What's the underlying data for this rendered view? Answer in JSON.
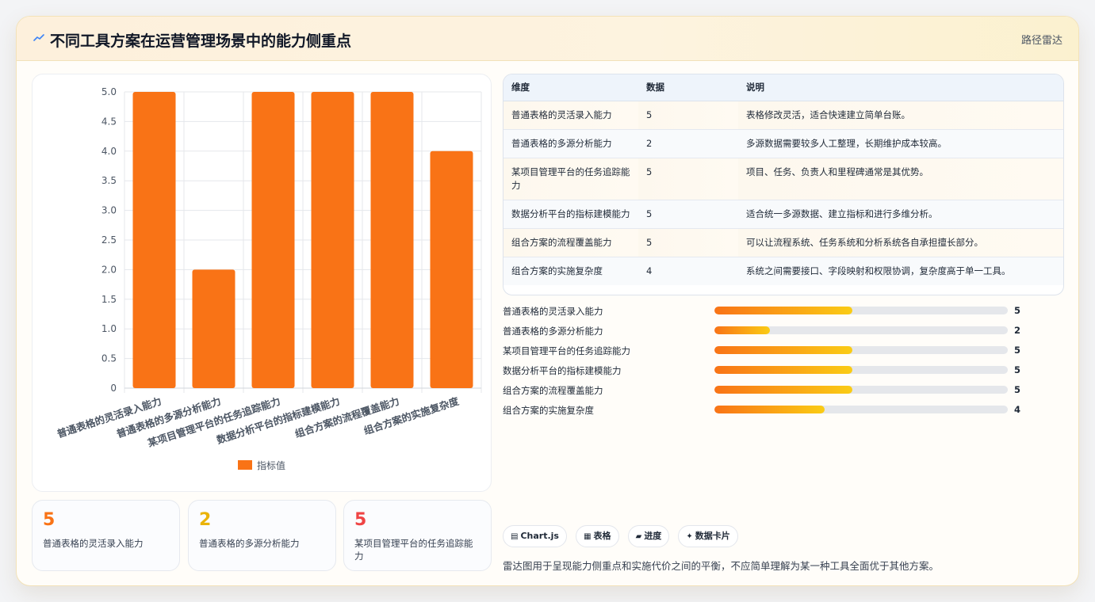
{
  "header": {
    "title": "不同工具方案在运营管理场景中的能力侧重点",
    "link_label": "路径雷达"
  },
  "colors": {
    "bar": "#f97316",
    "stat_orange": "#f97316",
    "stat_amber": "#eab308",
    "stat_red": "#ef4444",
    "progress_start": "#f97316",
    "progress_end": "#facc15"
  },
  "chart_data": {
    "type": "bar",
    "categories": [
      "普通表格的灵活录入能力",
      "普通表格的多源分析能力",
      "某项目管理平台的任务追踪能力",
      "数据分析平台的指标建模能力",
      "组合方案的流程覆盖能力",
      "组合方案的实施复杂度"
    ],
    "series": [
      {
        "name": "指标值",
        "values": [
          5,
          2,
          5,
          5,
          5,
          4
        ]
      }
    ],
    "ylim": [
      0,
      5
    ],
    "yticks": [
      "0",
      "0.5",
      "1.0",
      "1.5",
      "2.0",
      "2.5",
      "3.0",
      "3.5",
      "4.0",
      "4.5",
      "5.0"
    ],
    "grid": true,
    "legend": "bottom"
  },
  "stats": [
    {
      "value": "5",
      "label": "普通表格的灵活录入能力"
    },
    {
      "value": "2",
      "label": "普通表格的多源分析能力"
    },
    {
      "value": "5",
      "label": "某项目管理平台的任务追踪能力"
    }
  ],
  "table": {
    "headers": [
      "维度",
      "数据",
      "说明"
    ],
    "rows": [
      [
        "普通表格的灵活录入能力",
        "5",
        "表格修改灵活，适合快速建立简单台账。"
      ],
      [
        "普通表格的多源分析能力",
        "2",
        "多源数据需要较多人工整理，长期维护成本较高。"
      ],
      [
        "某项目管理平台的任务追踪能力",
        "5",
        "项目、任务、负责人和里程碑通常是其优势。"
      ],
      [
        "数据分析平台的指标建模能力",
        "5",
        "适合统一多源数据、建立指标和进行多维分析。"
      ],
      [
        "组合方案的流程覆盖能力",
        "5",
        "可以让流程系统、任务系统和分析系统各自承担擅长部分。"
      ],
      [
        "组合方案的实施复杂度",
        "4",
        "系统之间需要接口、字段映射和权限协调，复杂度高于单一工具。"
      ]
    ]
  },
  "progress": {
    "max": 5,
    "items": [
      {
        "label": "普通表格的灵活录入能力",
        "value": 5,
        "fill": 0.47
      },
      {
        "label": "普通表格的多源分析能力",
        "value": 2,
        "fill": 0.19
      },
      {
        "label": "某项目管理平台的任务追踪能力",
        "value": 5,
        "fill": 0.47
      },
      {
        "label": "数据分析平台的指标建模能力",
        "value": 5,
        "fill": 0.47
      },
      {
        "label": "组合方案的流程覆盖能力",
        "value": 5,
        "fill": 0.47
      },
      {
        "label": "组合方案的实施复杂度",
        "value": 4,
        "fill": 0.375
      }
    ]
  },
  "tags": [
    {
      "icon": "chart-icon",
      "glyph": "▤",
      "label": "Chart.js"
    },
    {
      "icon": "table-icon",
      "glyph": "▦",
      "label": "表格"
    },
    {
      "icon": "progress-icon",
      "glyph": "▰",
      "label": "进度"
    },
    {
      "icon": "sparkle-icon",
      "glyph": "✦",
      "label": "数据卡片"
    }
  ],
  "footnote": "雷达图用于呈现能力侧重点和实施代价之间的平衡，不应简单理解为某一种工具全面优于其他方案。"
}
